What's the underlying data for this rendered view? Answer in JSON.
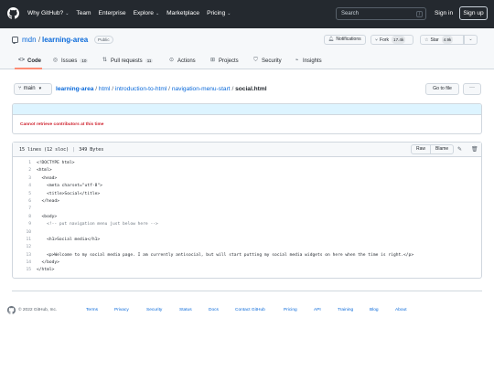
{
  "header": {
    "nav": [
      {
        "label": "Why GitHub?",
        "has_caret": true
      },
      {
        "label": "Team",
        "has_caret": false
      },
      {
        "label": "Enterprise",
        "has_caret": false
      },
      {
        "label": "Explore",
        "has_caret": true
      },
      {
        "label": "Marketplace",
        "has_caret": false
      },
      {
        "label": "Pricing",
        "has_caret": true
      }
    ],
    "search_placeholder": "Search",
    "search_shortcut": "/",
    "sign_in": "Sign in",
    "sign_up": "Sign up"
  },
  "repo": {
    "owner": "mdn",
    "separator": "/",
    "name": "learning-area",
    "visibility": "Public",
    "notifications_label": "Notifications",
    "fork_label": "Fork",
    "fork_count": "17.4k",
    "star_label": "Star",
    "star_count": "4.9k"
  },
  "tabs": [
    {
      "label": "Code",
      "icon": "code-icon",
      "count": ""
    },
    {
      "label": "Issues",
      "icon": "issue-icon",
      "count": "10"
    },
    {
      "label": "Pull requests",
      "icon": "pull-request-icon",
      "count": "11"
    },
    {
      "label": "Actions",
      "icon": "play-icon",
      "count": ""
    },
    {
      "label": "Projects",
      "icon": "table-icon",
      "count": ""
    },
    {
      "label": "Security",
      "icon": "shield-icon",
      "count": ""
    },
    {
      "label": "Insights",
      "icon": "graph-icon",
      "count": ""
    }
  ],
  "breadcrumb": {
    "branch": "main",
    "parts": [
      "learning-area",
      "html",
      "introduction-to-html",
      "navigation-menu-start"
    ],
    "file": "social.html",
    "go_to_file": "Go to file",
    "more": "···"
  },
  "error": {
    "message": "Cannot retrieve contributors at this time"
  },
  "file": {
    "lines_info": "15 lines (12 sloc)",
    "size": "349 Bytes",
    "raw": "Raw",
    "blame": "Blame",
    "code": [
      "<!DOCTYPE html>",
      "<html>",
      "  <head>",
      "    <meta charset=\"utf-8\">",
      "    <title>Social</title>",
      "  </head>",
      "",
      "  <body>",
      "    <!-- put navigation menu just below here -->",
      "",
      "    <h1>Social media</h1>",
      "",
      "    <p>Welcome to my social media page. I am currently antisocial, but will start putting my social media widgets on here when the time is right.</p>",
      "  </body>",
      "</html>"
    ]
  },
  "footer": {
    "copyright": "© 2022 GitHub, Inc.",
    "links": [
      "Terms",
      "Privacy",
      "Security",
      "Status",
      "Docs",
      "Contact GitHub",
      "Pricing",
      "API",
      "Training",
      "Blog",
      "About"
    ]
  },
  "colors": {
    "header_bg": "#24292f",
    "link": "#0969da",
    "tab_underline": "#fd8c73",
    "error": "#cf222e"
  }
}
